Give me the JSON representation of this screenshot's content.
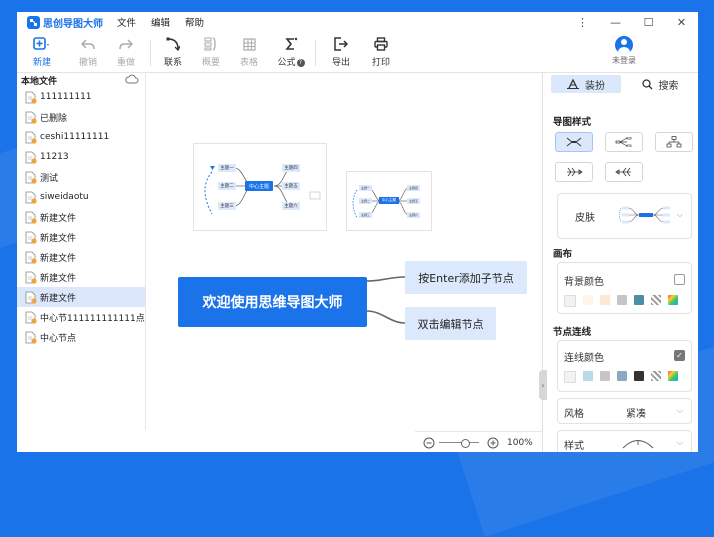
{
  "app": {
    "title": "思创导图大师"
  },
  "menu": [
    "文件",
    "编辑",
    "帮助"
  ],
  "toolbar": {
    "new": "新建",
    "undo": "撤销",
    "redo": "重做",
    "relation": "联系",
    "summary": "概要",
    "table": "表格",
    "formula": "公式",
    "export": "导出",
    "print": "打印",
    "login": "未登录"
  },
  "sidebar": {
    "heading": "本地文件",
    "files": [
      "111111111",
      "已删除",
      "ceshi11111111",
      "11213",
      "测试",
      "siweidaotu",
      "新建文件",
      "新建文件",
      "新建文件",
      "新建文件",
      "新建文件",
      "中心节111111111111点",
      "中心节点"
    ],
    "selected_index": 10
  },
  "templates": {
    "center": "中心主题",
    "topics": [
      "主题一",
      "主题二",
      "主题三",
      "主题四",
      "主题五",
      "主题六"
    ]
  },
  "mindmap": {
    "center": "欢迎使用思维导图大师",
    "children": [
      "按Enter添加子节点",
      "双击编辑节点"
    ]
  },
  "zoom": {
    "level": "100%"
  },
  "panel": {
    "tab_style": "装扮",
    "tab_search": "搜索",
    "section_layout": "导图样式",
    "skin_label": "皮肤",
    "section_canvas": "画布",
    "bg_color_label": "背景颜色",
    "section_lines": "节点连线",
    "line_color_label": "连线颜色",
    "style_label": "风格",
    "style_value": "紧凑",
    "type_label": "样式"
  },
  "colors": {
    "brand": "#1a73e8",
    "node_fill": "#dce8fb",
    "bg_swatches": [
      "#f2f2f2",
      "#fdf6e8",
      "#fde8d4",
      "#c5c5c5",
      "#4c8da7"
    ],
    "line_swatches": [
      "#f2f2f2",
      "#b9dbe6",
      "#c5c5c5",
      "#8aa9c4",
      "#333333"
    ]
  }
}
